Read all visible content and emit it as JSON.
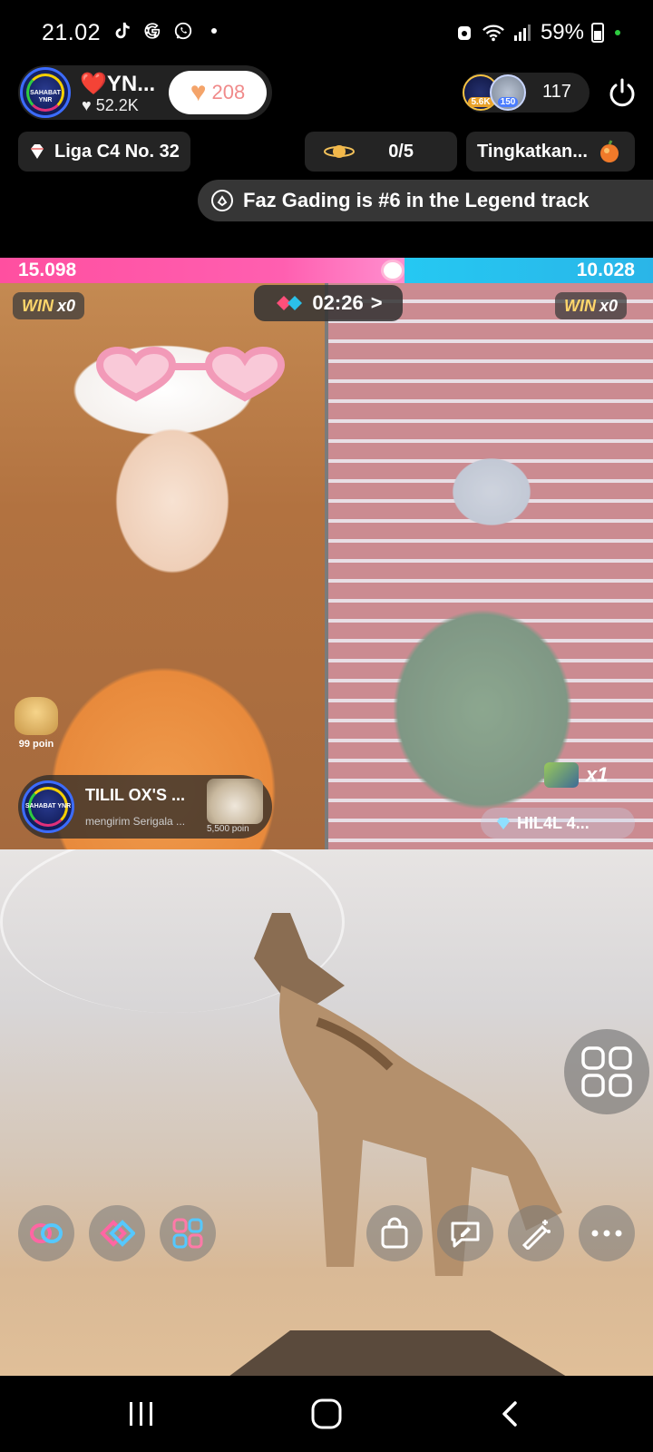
{
  "status_bar": {
    "time": "21.02",
    "battery_percent": "59%",
    "icons_left": [
      "tiktok-icon",
      "google-icon",
      "whatsapp-icon",
      "dot-icon"
    ],
    "icons_right": [
      "alarm-icon",
      "wifi-icon",
      "signal-icon",
      "battery-icon"
    ]
  },
  "host": {
    "name": "❤️YN...",
    "likes": "52.2K",
    "avatar_text": "SAHABAT YNR",
    "follow_count": "208"
  },
  "viewers": {
    "badge1": "5.6K",
    "badge2": "150",
    "count": "117"
  },
  "chips": {
    "league": "Liga C4 No. 32",
    "goal": "0/5",
    "upgrade": "Tingkatkan..."
  },
  "ticker": {
    "text": "Faz Gading is #6 in the Legend track"
  },
  "battle": {
    "left_score": "15.098",
    "right_score": "10.028",
    "left_fraction": 0.62,
    "win_left_label": "WIN",
    "win_left_count": "x0",
    "win_right_label": "WIN",
    "win_right_count": "x0",
    "timer": "02:26",
    "timer_arrow": ">"
  },
  "left_panel": {
    "poin_label": "99 poin",
    "gift_sender": "TILIL OX'S ...",
    "gift_message": "mengirim Serigala ...",
    "gift_value": "5,500 poin",
    "gift_avatar_text": "SAHABAT YNR"
  },
  "right_panel": {
    "combo": "x1",
    "user": "HIL4L 4..."
  },
  "colors": {
    "left_bar": "#ff5fb0",
    "right_bar": "#2ab5e8",
    "follow_heart": "#f4a46a",
    "win_gold": "#ffd66b"
  }
}
